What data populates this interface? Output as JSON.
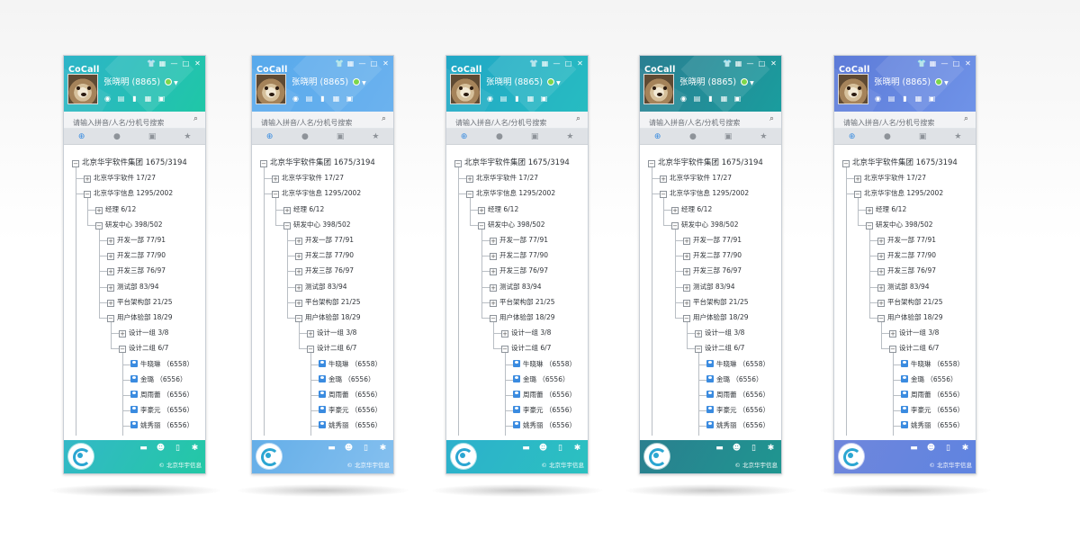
{
  "app_title": "CoCall",
  "user_name": "张晓明 (8865)",
  "search_placeholder": "请输入拼音/人名/分机号搜索",
  "copyright": "© 北京华宇信息",
  "window_controls": [
    "shirt-icon",
    "qr-icon",
    "minimize-icon",
    "maximize-icon",
    "close-icon"
  ],
  "toolbar_icons": [
    "location-icon",
    "list-icon",
    "chart-icon",
    "calendar-icon",
    "doc-icon"
  ],
  "tabs": [
    "org-tree-icon",
    "contact-icon",
    "group-icon",
    "favorite-icon"
  ],
  "footer_icons": [
    "chat-icon",
    "user-search-icon",
    "file-icon",
    "settings-icon"
  ],
  "themes": [
    {
      "header": [
        "#2eb4c8",
        "#1fc7a7"
      ],
      "footer": [
        "#33b8c7",
        "#23c8a5"
      ]
    },
    {
      "header": [
        "#57a9ec",
        "#6cb2ee"
      ],
      "footer": [
        "#64aee8",
        "#85c0ef"
      ]
    },
    {
      "header": [
        "#21a7c6",
        "#27bcc1"
      ],
      "footer": [
        "#2cb0cc",
        "#2bc1c0"
      ]
    },
    {
      "header": [
        "#2a7f92",
        "#1a9d9e"
      ],
      "footer": [
        "#2a7f8f",
        "#1f9690"
      ]
    },
    {
      "header": [
        "#5d7bd8",
        "#6f93e8"
      ],
      "footer": [
        "#6f86dc",
        "#5f84e0"
      ]
    }
  ],
  "tree": [
    {
      "label": "北京华宇软件集团 1675/3194",
      "depth": 0,
      "kind": "minus"
    },
    {
      "label": "北京华宇软件 17/27",
      "depth": 1,
      "kind": "plus"
    },
    {
      "label": "北京华宇信息 1295/2002",
      "depth": 1,
      "kind": "minus"
    },
    {
      "label": "经理 6/12",
      "depth": 2,
      "kind": "plus"
    },
    {
      "label": "研发中心 398/502",
      "depth": 2,
      "kind": "minus"
    },
    {
      "label": "开发一部 77/91",
      "depth": 3,
      "kind": "plus"
    },
    {
      "label": "开发二部 77/90",
      "depth": 3,
      "kind": "plus"
    },
    {
      "label": "开发三部 76/97",
      "depth": 3,
      "kind": "plus"
    },
    {
      "label": "测试部 83/94",
      "depth": 3,
      "kind": "plus"
    },
    {
      "label": "平台架构部 21/25",
      "depth": 3,
      "kind": "plus"
    },
    {
      "label": "用户体验部 18/29",
      "depth": 3,
      "kind": "minus"
    },
    {
      "label": "设计一组 3/8",
      "depth": 4,
      "kind": "plus"
    },
    {
      "label": "设计二组 6/7",
      "depth": 4,
      "kind": "minus"
    },
    {
      "label": "牛晓琳 （6558）",
      "depth": 5,
      "kind": "user"
    },
    {
      "label": "金璐 （6556）",
      "depth": 5,
      "kind": "user"
    },
    {
      "label": "周雨蕾 （6556）",
      "depth": 5,
      "kind": "user"
    },
    {
      "label": "李豪元 （6556）",
      "depth": 5,
      "kind": "user"
    },
    {
      "label": "姚秀丽 （6556）",
      "depth": 5,
      "kind": "user"
    },
    {
      "label": "曹文婷 （6556）",
      "depth": 5,
      "kind": "offline"
    }
  ]
}
